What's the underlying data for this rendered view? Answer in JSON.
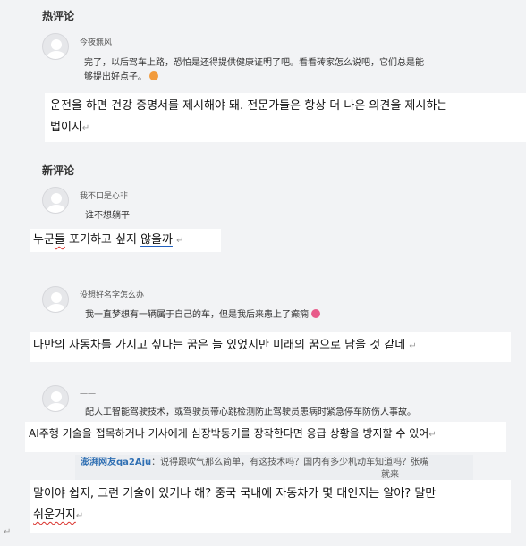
{
  "hot": {
    "title": "热评论",
    "user": "今夜無风",
    "text_line1": "完了，以后驾车上路，恐怕是还得提供健康证明了吧。看看砖家怎么说吧，它们总是能",
    "text_line2": "够提出好点子。"
  },
  "ko_hot": {
    "line1": "운전을 하면 건강 증명서를 제시해야 돼. 전문가들은 항상 더 나은 의견을 제시하는",
    "line2": "법이지"
  },
  "new": {
    "title": "新评论",
    "c1_user": "我不口是心非",
    "c1_text": "谁不想躺平",
    "c2_user": "没想好名字怎么办",
    "c2_text": "我一直梦想有一辆属于自己的车，但是我后来患上了癫痫",
    "c3_user": "一一",
    "c3_text": "配人工智能驾驶技术，或驾驶员带心跳检测防止驾驶员患病时紧急停车防伤人事故。",
    "reply_user": "澎湃网友qa2Aju",
    "reply_text": "：说得跟吹气那么简单，有这技术吗？国内有多少机动车知道吗？张嘴",
    "reply_text2": "就来"
  },
  "ko1": {
    "pre": "누군",
    "sq": "들",
    "mid": " 포기하고 싶지 ",
    "ul": "않을까"
  },
  "ko2": {
    "text": "나만의 자동차를 가지고 싶다는 꿈은 늘 있었지만 미래의 꿈으로 남을 것 같네"
  },
  "ko3": {
    "text": "AI주행 기술을 접목하거나 기사에게 심장박동기를 장착한다면 응급 상황을 방지할 수 있어"
  },
  "ko4": {
    "line1": "말이야 쉽지, 그런 기술이 있기나 해? 중국 국내에 자동차가 몇 대인지는 알아? 말만",
    "line2_sq": "쉬운거지"
  },
  "marks": {
    "para": "↵"
  },
  "colors": {
    "reply_name": "#2f6fb3",
    "spell_squiggle": "#d9322c",
    "grammar_underline": "#1f5fbf"
  }
}
